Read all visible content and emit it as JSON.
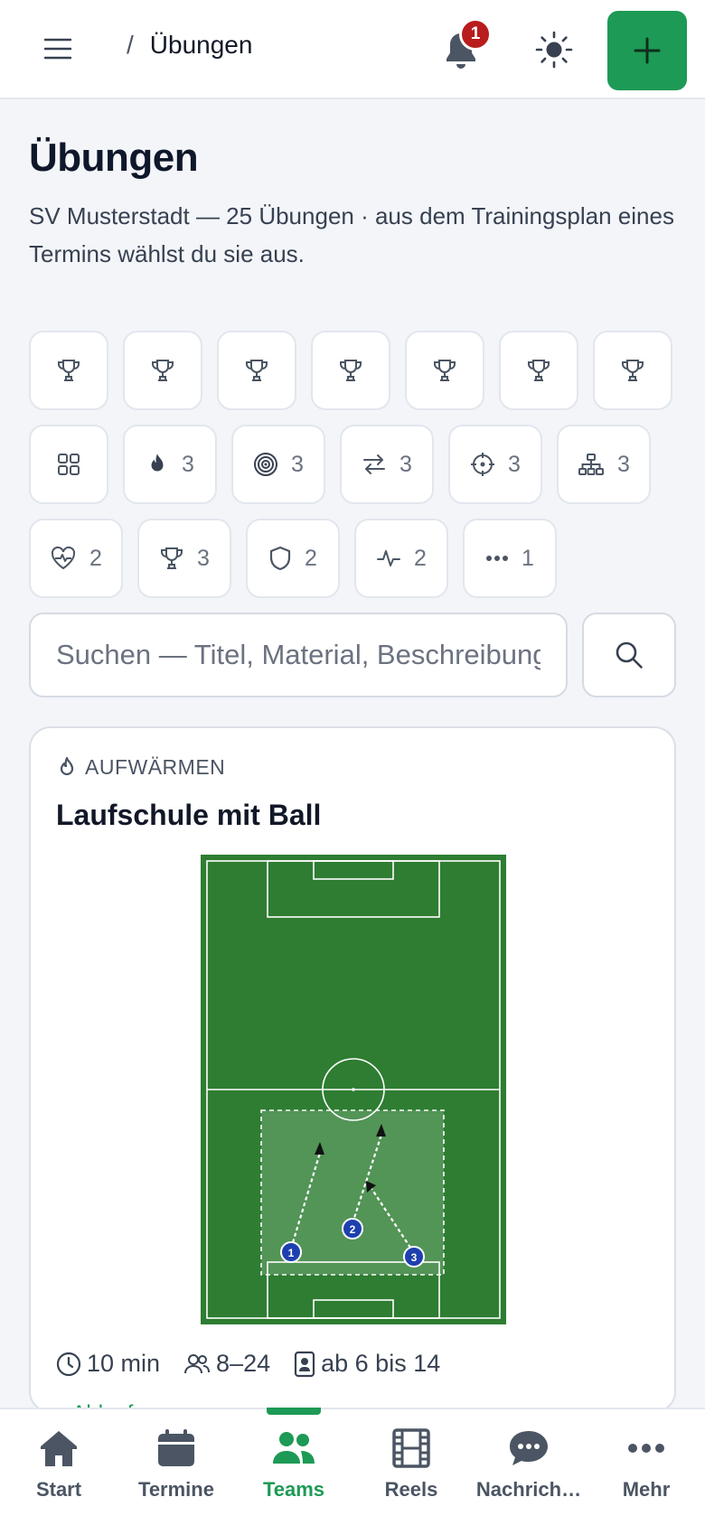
{
  "header": {
    "breadcrumb_sep": "/",
    "breadcrumb_current": "Übungen",
    "notification_count": "1",
    "accent_color": "#1d9a55"
  },
  "page": {
    "title": "Übungen",
    "subtitle": "SV Musterstadt — 25 Übungen · aus dem Trainingsplan eines Termins wählst du sie aus."
  },
  "filters": {
    "row1": [
      "trophy-icon",
      "trophy-icon",
      "trophy-icon",
      "trophy-icon",
      "trophy-icon",
      "trophy-icon",
      "trophy-icon"
    ],
    "row2": [
      {
        "icon": "grid-icon",
        "count": ""
      },
      {
        "icon": "flame-icon",
        "count": "3"
      },
      {
        "icon": "target-icon",
        "count": "3"
      },
      {
        "icon": "arrows-exchange-icon",
        "count": "3"
      },
      {
        "icon": "crosshair-icon",
        "count": "3"
      },
      {
        "icon": "hierarchy-icon",
        "count": "3"
      }
    ],
    "row3": [
      {
        "icon": "heart-pulse-icon",
        "count": "2"
      },
      {
        "icon": "trophy-icon",
        "count": "3"
      },
      {
        "icon": "shield-icon",
        "count": "2"
      },
      {
        "icon": "activity-icon",
        "count": "2"
      },
      {
        "icon": "more-icon",
        "count": "1"
      }
    ]
  },
  "search": {
    "placeholder": "Suchen — Titel, Material, Beschreibung"
  },
  "exercise": {
    "category": "AUFWÄRMEN",
    "title": "Laufschule mit Ball",
    "players": [
      "1",
      "2",
      "3"
    ],
    "duration": "10 min",
    "group_size": "8–24",
    "age": "ab 6 bis 14",
    "next_line": "▸ Ablauf"
  },
  "nav": {
    "items": [
      {
        "label": "Start",
        "icon": "home-icon"
      },
      {
        "label": "Termine",
        "icon": "calendar-icon"
      },
      {
        "label": "Teams",
        "icon": "users-icon"
      },
      {
        "label": "Reels",
        "icon": "film-icon"
      },
      {
        "label": "Nachrich…",
        "icon": "chat-icon"
      },
      {
        "label": "Mehr",
        "icon": "more-icon"
      }
    ],
    "active": "Teams"
  }
}
